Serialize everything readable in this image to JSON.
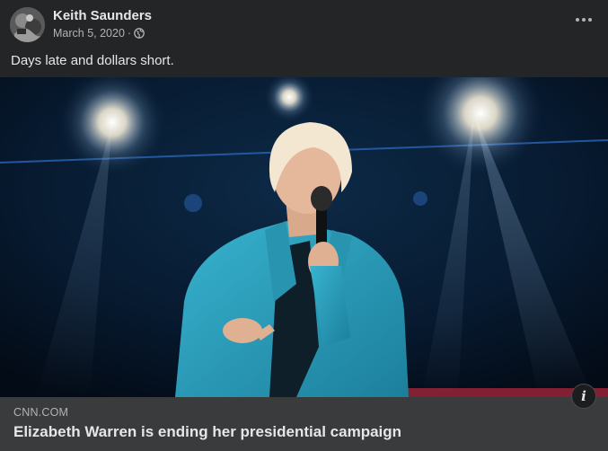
{
  "post": {
    "author": "Keith Saunders",
    "timestamp": "March 5, 2020",
    "separator": "·",
    "audience_icon": "globe-icon",
    "menu_icon": "more-horizontal-icon",
    "caption": "Days late and dollars short."
  },
  "link_preview": {
    "domain": "CNN.COM",
    "headline": "Elizabeth Warren is ending her presidential campaign",
    "info_icon": "info-icon",
    "info_label": "i"
  },
  "colors": {
    "background": "#242526",
    "link_box": "#3a3b3c",
    "primary_text": "#e4e6eb",
    "secondary_text": "#b0b3b8",
    "jacket": "#2aa3bf"
  }
}
